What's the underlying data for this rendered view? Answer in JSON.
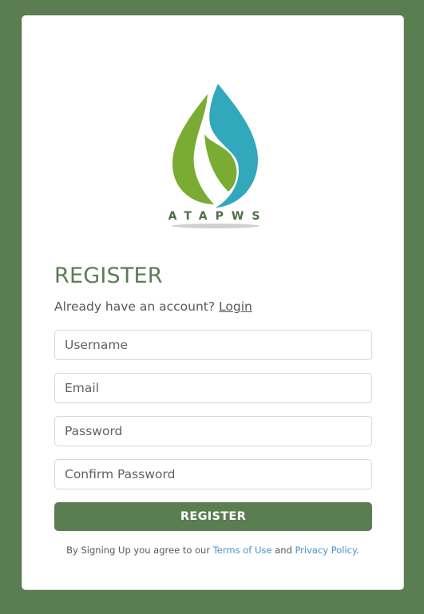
{
  "logo": {
    "text": "ATAPWS",
    "colors": {
      "leaf": "#7aab32",
      "drop": "#31a8bc",
      "text": "#4e6f43"
    }
  },
  "form": {
    "title": "REGISTER",
    "account_prompt": "Already have an account?",
    "login_link": "Login",
    "username_placeholder": "Username",
    "email_placeholder": "Email",
    "password_placeholder": "Password",
    "confirm_placeholder": "Confirm Password",
    "submit_label": "REGISTER",
    "terms_prefix": "By Signing Up you agree to our",
    "terms_link": "Terms of Use",
    "terms_and": "and",
    "privacy_link": "Privacy Policy",
    "terms_suffix": "."
  },
  "theme": {
    "brand_green": "#5a7d52",
    "link_blue": "#4a8fcf"
  }
}
